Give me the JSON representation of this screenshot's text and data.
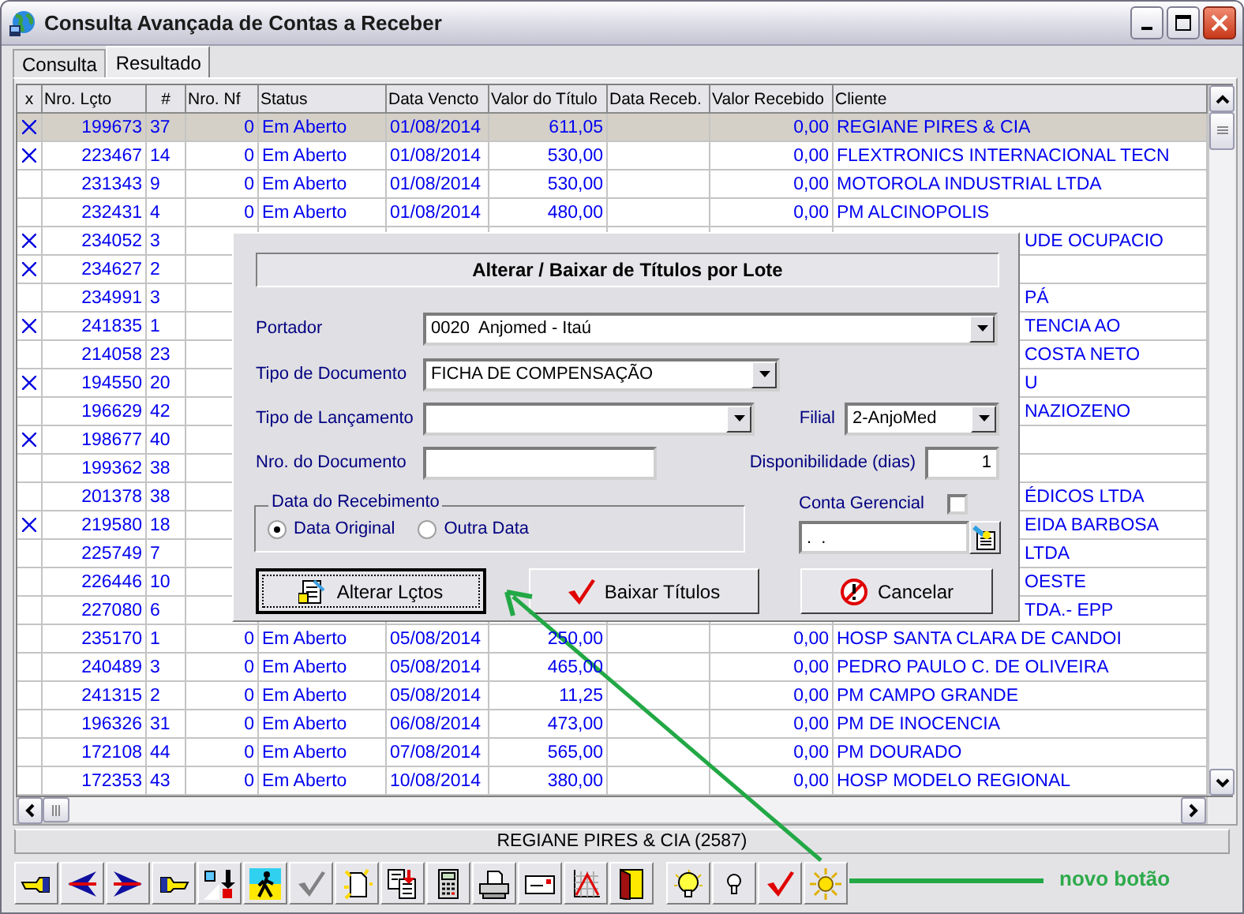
{
  "window": {
    "title": "Consulta Avançada de Contas a Receber"
  },
  "tabs": [
    {
      "label": "Consulta",
      "selected": false
    },
    {
      "label": "Resultado",
      "selected": true
    }
  ],
  "table": {
    "columns": [
      "x",
      "Nro. Lçto",
      "#",
      "Nro. Nf",
      "Status",
      "Data Vencto",
      "Valor do Título",
      "Data Receb.",
      "Valor Recebido",
      "Cliente"
    ],
    "rows": [
      {
        "kind": "full",
        "selected": true,
        "checked": true,
        "nro_lcto": "199673",
        "num": "37",
        "nro_nf": "0",
        "status": "Em Aberto",
        "data_vencto": "01/08/2014",
        "valor_titulo": "611,05",
        "valor_recebido": "0,00",
        "cliente": "REGIANE PIRES & CIA"
      },
      {
        "kind": "full",
        "selected": false,
        "checked": true,
        "nro_lcto": "223467",
        "num": "14",
        "nro_nf": "0",
        "status": "Em Aberto",
        "data_vencto": "01/08/2014",
        "valor_titulo": "530,00",
        "valor_recebido": "0,00",
        "cliente": "FLEXTRONICS INTERNACIONAL TECN"
      },
      {
        "kind": "full",
        "selected": false,
        "checked": false,
        "nro_lcto": "231343",
        "num": "9",
        "nro_nf": "0",
        "status": "Em Aberto",
        "data_vencto": "01/08/2014",
        "valor_titulo": "530,00",
        "valor_recebido": "0,00",
        "cliente": "MOTOROLA INDUSTRIAL LTDA"
      },
      {
        "kind": "full",
        "selected": false,
        "checked": false,
        "nro_lcto": "232431",
        "num": "4",
        "nro_nf": "0",
        "status": "Em Aberto",
        "data_vencto": "01/08/2014",
        "valor_titulo": "480,00",
        "valor_recebido": "0,00",
        "cliente": "PM ALCINOPOLIS"
      },
      {
        "kind": "covered",
        "selected": false,
        "checked": true,
        "nro_lcto": "234052",
        "num": "3",
        "cliente": "UDE OCUPACIO"
      },
      {
        "kind": "covered",
        "selected": false,
        "checked": true,
        "nro_lcto": "234627",
        "num": "2"
      },
      {
        "kind": "covered",
        "selected": false,
        "checked": false,
        "nro_lcto": "234991",
        "num": "3",
        "cliente": "PÁ"
      },
      {
        "kind": "covered",
        "selected": false,
        "checked": true,
        "nro_lcto": "241835",
        "num": "1",
        "cliente": "TENCIA AO"
      },
      {
        "kind": "covered",
        "selected": false,
        "checked": false,
        "nro_lcto": "214058",
        "num": "23",
        "cliente": "COSTA NETO"
      },
      {
        "kind": "covered",
        "selected": false,
        "checked": true,
        "nro_lcto": "194550",
        "num": "20",
        "cliente": "U"
      },
      {
        "kind": "covered",
        "selected": false,
        "checked": false,
        "nro_lcto": "196629",
        "num": "42",
        "cliente": "NAZIOZENO"
      },
      {
        "kind": "covered",
        "selected": false,
        "checked": true,
        "nro_lcto": "198677",
        "num": "40"
      },
      {
        "kind": "covered",
        "selected": false,
        "checked": false,
        "nro_lcto": "199362",
        "num": "38"
      },
      {
        "kind": "covered",
        "selected": false,
        "checked": false,
        "nro_lcto": "201378",
        "num": "38",
        "cliente": "ÉDICOS LTDA"
      },
      {
        "kind": "covered",
        "selected": false,
        "checked": true,
        "nro_lcto": "219580",
        "num": "18",
        "cliente": "EIDA BARBOSA"
      },
      {
        "kind": "covered",
        "selected": false,
        "checked": false,
        "nro_lcto": "225749",
        "num": "7",
        "cliente": "LTDA"
      },
      {
        "kind": "covered",
        "selected": false,
        "checked": false,
        "nro_lcto": "226446",
        "num": "10",
        "cliente": "OESTE"
      },
      {
        "kind": "covered",
        "selected": false,
        "checked": false,
        "nro_lcto": "227080",
        "num": "6",
        "cliente": "TDA.- EPP"
      },
      {
        "kind": "full",
        "selected": false,
        "checked": false,
        "nro_lcto": "235170",
        "num": "1",
        "nro_nf": "0",
        "status": "Em Aberto",
        "data_vencto": "05/08/2014",
        "valor_titulo": "250,00",
        "valor_recebido": "0,00",
        "cliente": "HOSP SANTA CLARA DE CANDOI"
      },
      {
        "kind": "full",
        "selected": false,
        "checked": false,
        "nro_lcto": "240489",
        "num": "3",
        "nro_nf": "0",
        "status": "Em Aberto",
        "data_vencto": "05/08/2014",
        "valor_titulo": "465,00",
        "valor_recebido": "0,00",
        "cliente": "PEDRO PAULO C. DE OLIVEIRA"
      },
      {
        "kind": "full",
        "selected": false,
        "checked": false,
        "nro_lcto": "241315",
        "num": "2",
        "nro_nf": "0",
        "status": "Em Aberto",
        "data_vencto": "05/08/2014",
        "valor_titulo": "11,25",
        "valor_recebido": "0,00",
        "cliente": "PM CAMPO GRANDE"
      },
      {
        "kind": "full",
        "selected": false,
        "checked": false,
        "nro_lcto": "196326",
        "num": "31",
        "nro_nf": "0",
        "status": "Em Aberto",
        "data_vencto": "06/08/2014",
        "valor_titulo": "473,00",
        "valor_recebido": "0,00",
        "cliente": "PM DE INOCENCIA"
      },
      {
        "kind": "full",
        "selected": false,
        "checked": false,
        "nro_lcto": "172108",
        "num": "44",
        "nro_nf": "0",
        "status": "Em Aberto",
        "data_vencto": "07/08/2014",
        "valor_titulo": "565,00",
        "valor_recebido": "0,00",
        "cliente": "PM DOURADO"
      },
      {
        "kind": "full",
        "selected": false,
        "checked": false,
        "nro_lcto": "172353",
        "num": "43",
        "nro_nf": "0",
        "status": "Em Aberto",
        "data_vencto": "10/08/2014",
        "valor_titulo": "380,00",
        "valor_recebido": "0,00",
        "cliente": "HOSP MODELO REGIONAL"
      }
    ]
  },
  "status_bar": "REGIANE PIRES & CIA (2587)",
  "toolbar": [
    {
      "buttons": [
        {
          "kind": "hand-left",
          "disabled": false
        },
        {
          "kind": "arrow-left",
          "disabled": false
        },
        {
          "kind": "arrow-right",
          "disabled": false
        },
        {
          "kind": "hand-right",
          "disabled": false
        },
        {
          "kind": "transfer",
          "disabled": false
        },
        {
          "kind": "walker",
          "disabled": false
        },
        {
          "kind": "check",
          "disabled": true
        },
        {
          "kind": "new-doc",
          "disabled": false
        },
        {
          "kind": "docs",
          "disabled": false
        },
        {
          "kind": "calculator",
          "disabled": false
        },
        {
          "kind": "printer",
          "disabled": false
        },
        {
          "kind": "envelope",
          "disabled": false
        },
        {
          "kind": "chart",
          "disabled": false
        },
        {
          "kind": "door",
          "disabled": false
        }
      ]
    },
    {
      "buttons": [
        {
          "kind": "bulb-lit",
          "disabled": false
        },
        {
          "kind": "bulb",
          "disabled": false
        },
        {
          "kind": "check",
          "disabled": false
        },
        {
          "kind": "sun",
          "disabled": false
        }
      ]
    }
  ],
  "dialog": {
    "title": "Alterar / Baixar de Títulos por Lote",
    "portador": {
      "label": "Portador",
      "value": "0020  Anjomed - Itaú"
    },
    "tipo_documento": {
      "label": "Tipo de Documento",
      "value": "FICHA DE COMPENSAÇÃO"
    },
    "tipo_lancamento": {
      "label": "Tipo de Lançamento"
    },
    "filial": {
      "label": "Filial",
      "value": "2-AnjoMed"
    },
    "nro_documento": {
      "label": "Nro. do Documento"
    },
    "disponibilidade": {
      "label": "Disponibilidade (dias)",
      "value": "1"
    },
    "data_recebimento": {
      "legend": "Data do Recebimento",
      "options": [
        {
          "label": "Data Original",
          "selected": true
        },
        {
          "label": "Outra Data",
          "selected": false
        }
      ]
    },
    "conta_gerencial": {
      "label": "Conta Gerencial",
      "checked": false,
      "value": ".  ."
    },
    "buttons": [
      {
        "kind": "alterar",
        "label": "Alterar Lçtos",
        "focused": true
      },
      {
        "kind": "baixar",
        "label": "Baixar Títulos",
        "focused": false
      },
      {
        "kind": "cancelar",
        "label": "Cancelar",
        "focused": false
      }
    ]
  },
  "annotation": {
    "text": "novo botão"
  }
}
